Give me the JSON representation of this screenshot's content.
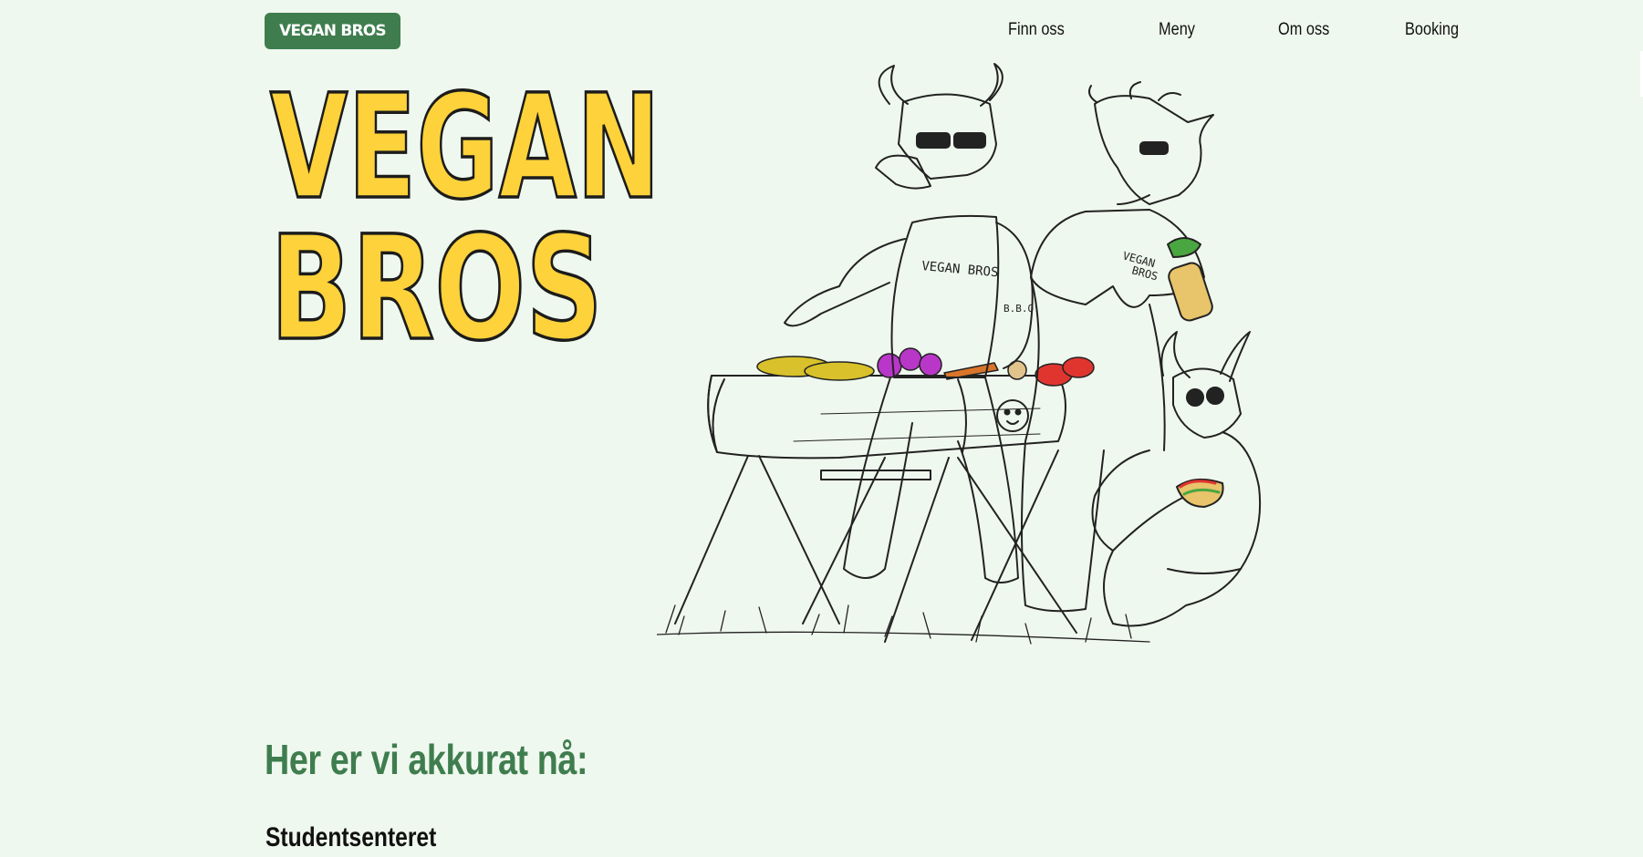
{
  "header": {
    "logo_label": "VEGAN BROS",
    "nav": [
      {
        "label": "Finn oss"
      },
      {
        "label": "Meny"
      },
      {
        "label": "Om oss"
      },
      {
        "label": "Booking"
      }
    ]
  },
  "hero": {
    "title_line1": "VEGAN",
    "title_line2": "BROS",
    "title_color": "#fdd23a",
    "apron_text_1": "VEGAN BROS",
    "apron_text_2": "VEGAN",
    "apron_text_3": "BROS",
    "tattoo_text": "B.B.Q."
  },
  "main": {
    "heading": "Her er vi akkurat nå:",
    "location": "Studentsenteret"
  },
  "colors": {
    "background": "#eff8ee",
    "brand_green": "#3f7d4f",
    "accent_yellow": "#fdd23a"
  }
}
